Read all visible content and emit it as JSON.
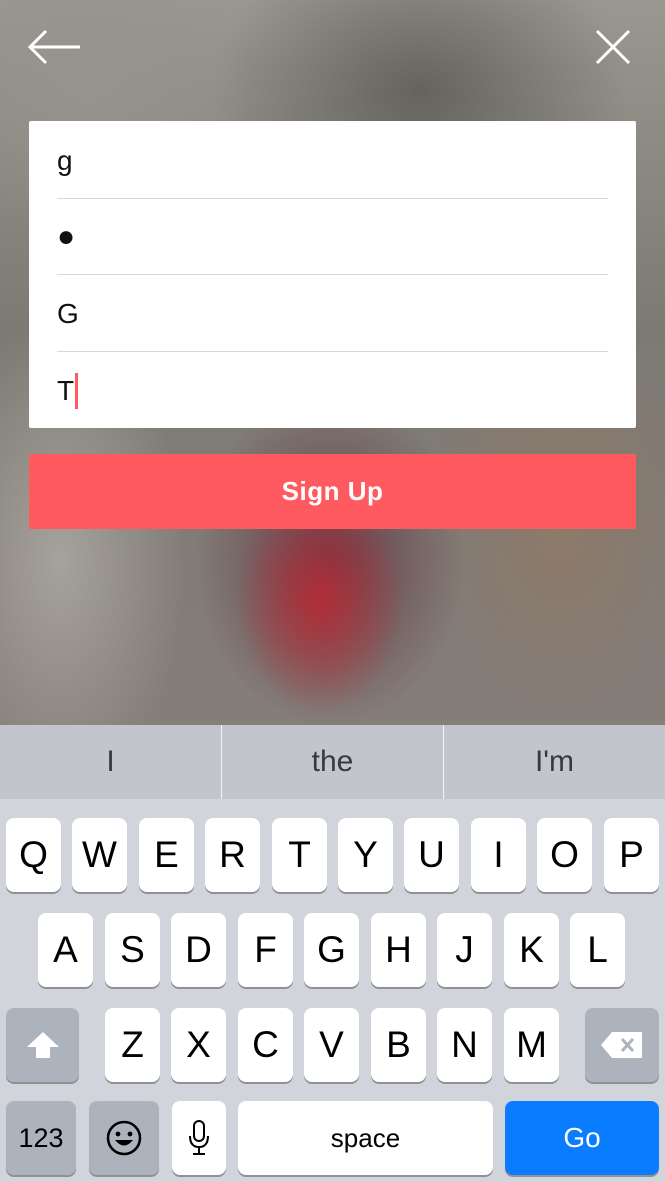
{
  "form": {
    "field_1_value": "g",
    "field_2_value": "●",
    "field_3_value": "G",
    "field_4_value": "T"
  },
  "signup_button": {
    "label": "Sign Up"
  },
  "keyboard": {
    "suggestions": [
      "I",
      "the",
      "I'm"
    ],
    "row1": [
      "Q",
      "W",
      "E",
      "R",
      "T",
      "Y",
      "U",
      "I",
      "O",
      "P"
    ],
    "row2": [
      "A",
      "S",
      "D",
      "F",
      "G",
      "H",
      "J",
      "K",
      "L"
    ],
    "row3": [
      "Z",
      "X",
      "C",
      "V",
      "B",
      "N",
      "M"
    ],
    "numbers_label": "123",
    "space_label": "space",
    "go_label": "Go"
  },
  "colors": {
    "accent": "#ff5a5f",
    "go_key": "#0a7cff"
  },
  "icons": [
    "back-arrow-icon",
    "close-icon",
    "shift-icon",
    "delete-icon",
    "emoji-icon",
    "microphone-icon"
  ]
}
